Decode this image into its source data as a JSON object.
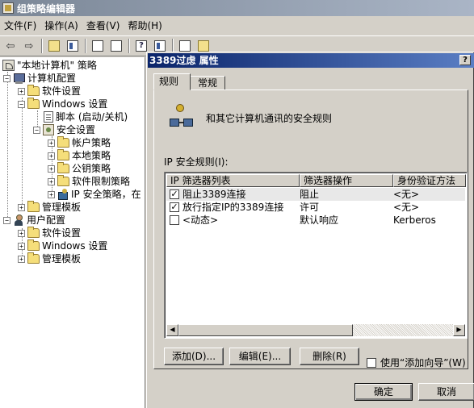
{
  "window": {
    "title": "组策略编辑器"
  },
  "menu": [
    {
      "label": "文件(F)"
    },
    {
      "label": "操作(A)"
    },
    {
      "label": "查看(V)"
    },
    {
      "label": "帮助(H)"
    }
  ],
  "tree": {
    "root": "\"本地计算机\" 策略",
    "computer_config": "计算机配置",
    "software_settings": "软件设置",
    "windows_settings": "Windows 设置",
    "scripts": "脚本 (启动/关机)",
    "security_settings": "安全设置",
    "account_policies": "帐户策略",
    "local_policies": "本地策略",
    "public_key": "公钥策略",
    "software_restriction": "软件限制策略",
    "ipsec": "IP 安全策略，在",
    "admin_templates": "管理模板",
    "user_config": "用户配置",
    "user_software_settings": "软件设置",
    "user_windows_settings": "Windows 设置",
    "user_admin_templates": "管理模板"
  },
  "dialog": {
    "title": "3389过虑 属性",
    "help": "?",
    "tabs": [
      {
        "label": "规则"
      },
      {
        "label": "常规"
      }
    ],
    "description": "和其它计算机通讯的安全规则",
    "list_label": "IP 安全规则(I):",
    "columns": [
      "IP 筛选器列表",
      "筛选器操作",
      "身份验证方法"
    ],
    "rules": [
      {
        "checked": true,
        "filter": "阻止3389连接",
        "action": "阻止",
        "auth": "<无>"
      },
      {
        "checked": true,
        "filter": "放行指定IP的3389连接",
        "action": "许可",
        "auth": "<无>"
      },
      {
        "checked": false,
        "filter": "<动态>",
        "action": "默认响应",
        "auth": "Kerberos"
      }
    ],
    "buttons": {
      "add": "添加(D)...",
      "edit": "编辑(E)...",
      "delete": "删除(R)",
      "wizard": "使用“添加向导”(W)",
      "ok": "确定",
      "cancel": "取消"
    }
  }
}
